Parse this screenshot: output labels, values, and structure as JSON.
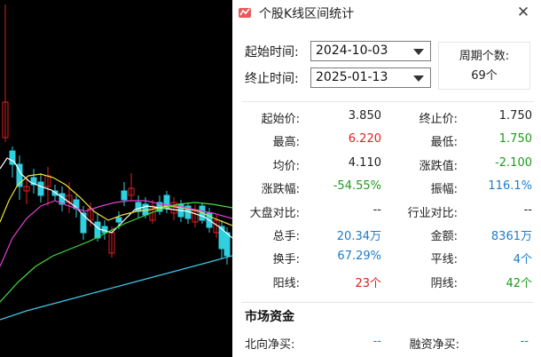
{
  "window": {
    "title": "个股K线区间统计"
  },
  "range": {
    "start_label": "起始时间:",
    "start_value": "2024-10-03",
    "end_label": "终止时间:",
    "end_value": "2025-01-13",
    "period_label": "周期个数:",
    "period_value": "69个"
  },
  "stats": [
    {
      "label": "起始价:",
      "value": "3.850",
      "color": "#222222",
      "label2": "终止价:",
      "value2": "1.750",
      "color2": "#222222"
    },
    {
      "label": "最高:",
      "value": "6.220",
      "color": "#e02020",
      "label2": "最低:",
      "value2": "1.750",
      "color2": "#1f9a1f"
    },
    {
      "label": "均价:",
      "value": "4.110",
      "color": "#222222",
      "label2": "涨跌值:",
      "value2": "-2.100",
      "color2": "#1f9a1f"
    },
    {
      "label": "涨跌幅:",
      "value": "-54.55%",
      "color": "#1f9a1f",
      "label2": "振幅:",
      "value2": "116.1%",
      "color2": "#1e7bc8"
    },
    {
      "label": "大盘对比:",
      "value": "--",
      "color": "#222222",
      "label2": "行业对比:",
      "value2": "--",
      "color2": "#222222"
    },
    {
      "label": "总手:",
      "value": "20.34万",
      "color": "#1e7bc8",
      "label2": "金额:",
      "value2": "8361万",
      "color2": "#1e7bc8"
    },
    {
      "label": "换手:",
      "value": "67.29%",
      "color": "#1e7bc8",
      "label2": "平线:",
      "value2": "4个",
      "color2": "#1e7bc8"
    },
    {
      "label": "阳线:",
      "value": "23个",
      "color": "#e02020",
      "label2": "阴线:",
      "value2": "42个",
      "color2": "#1f9a1f"
    }
  ],
  "market": {
    "title": "市场资金",
    "north_label": "北向净买:",
    "north_value": "--",
    "margin_label": "融资净买:",
    "margin_value": "--"
  },
  "colors": {
    "up": "#e02020",
    "down": "#2fd0e0",
    "ma5": "#ffffff",
    "ma10": "#f0e040",
    "ma20": "#e040d0",
    "ma30": "#40e040",
    "ma60": "#40c8e8"
  }
}
